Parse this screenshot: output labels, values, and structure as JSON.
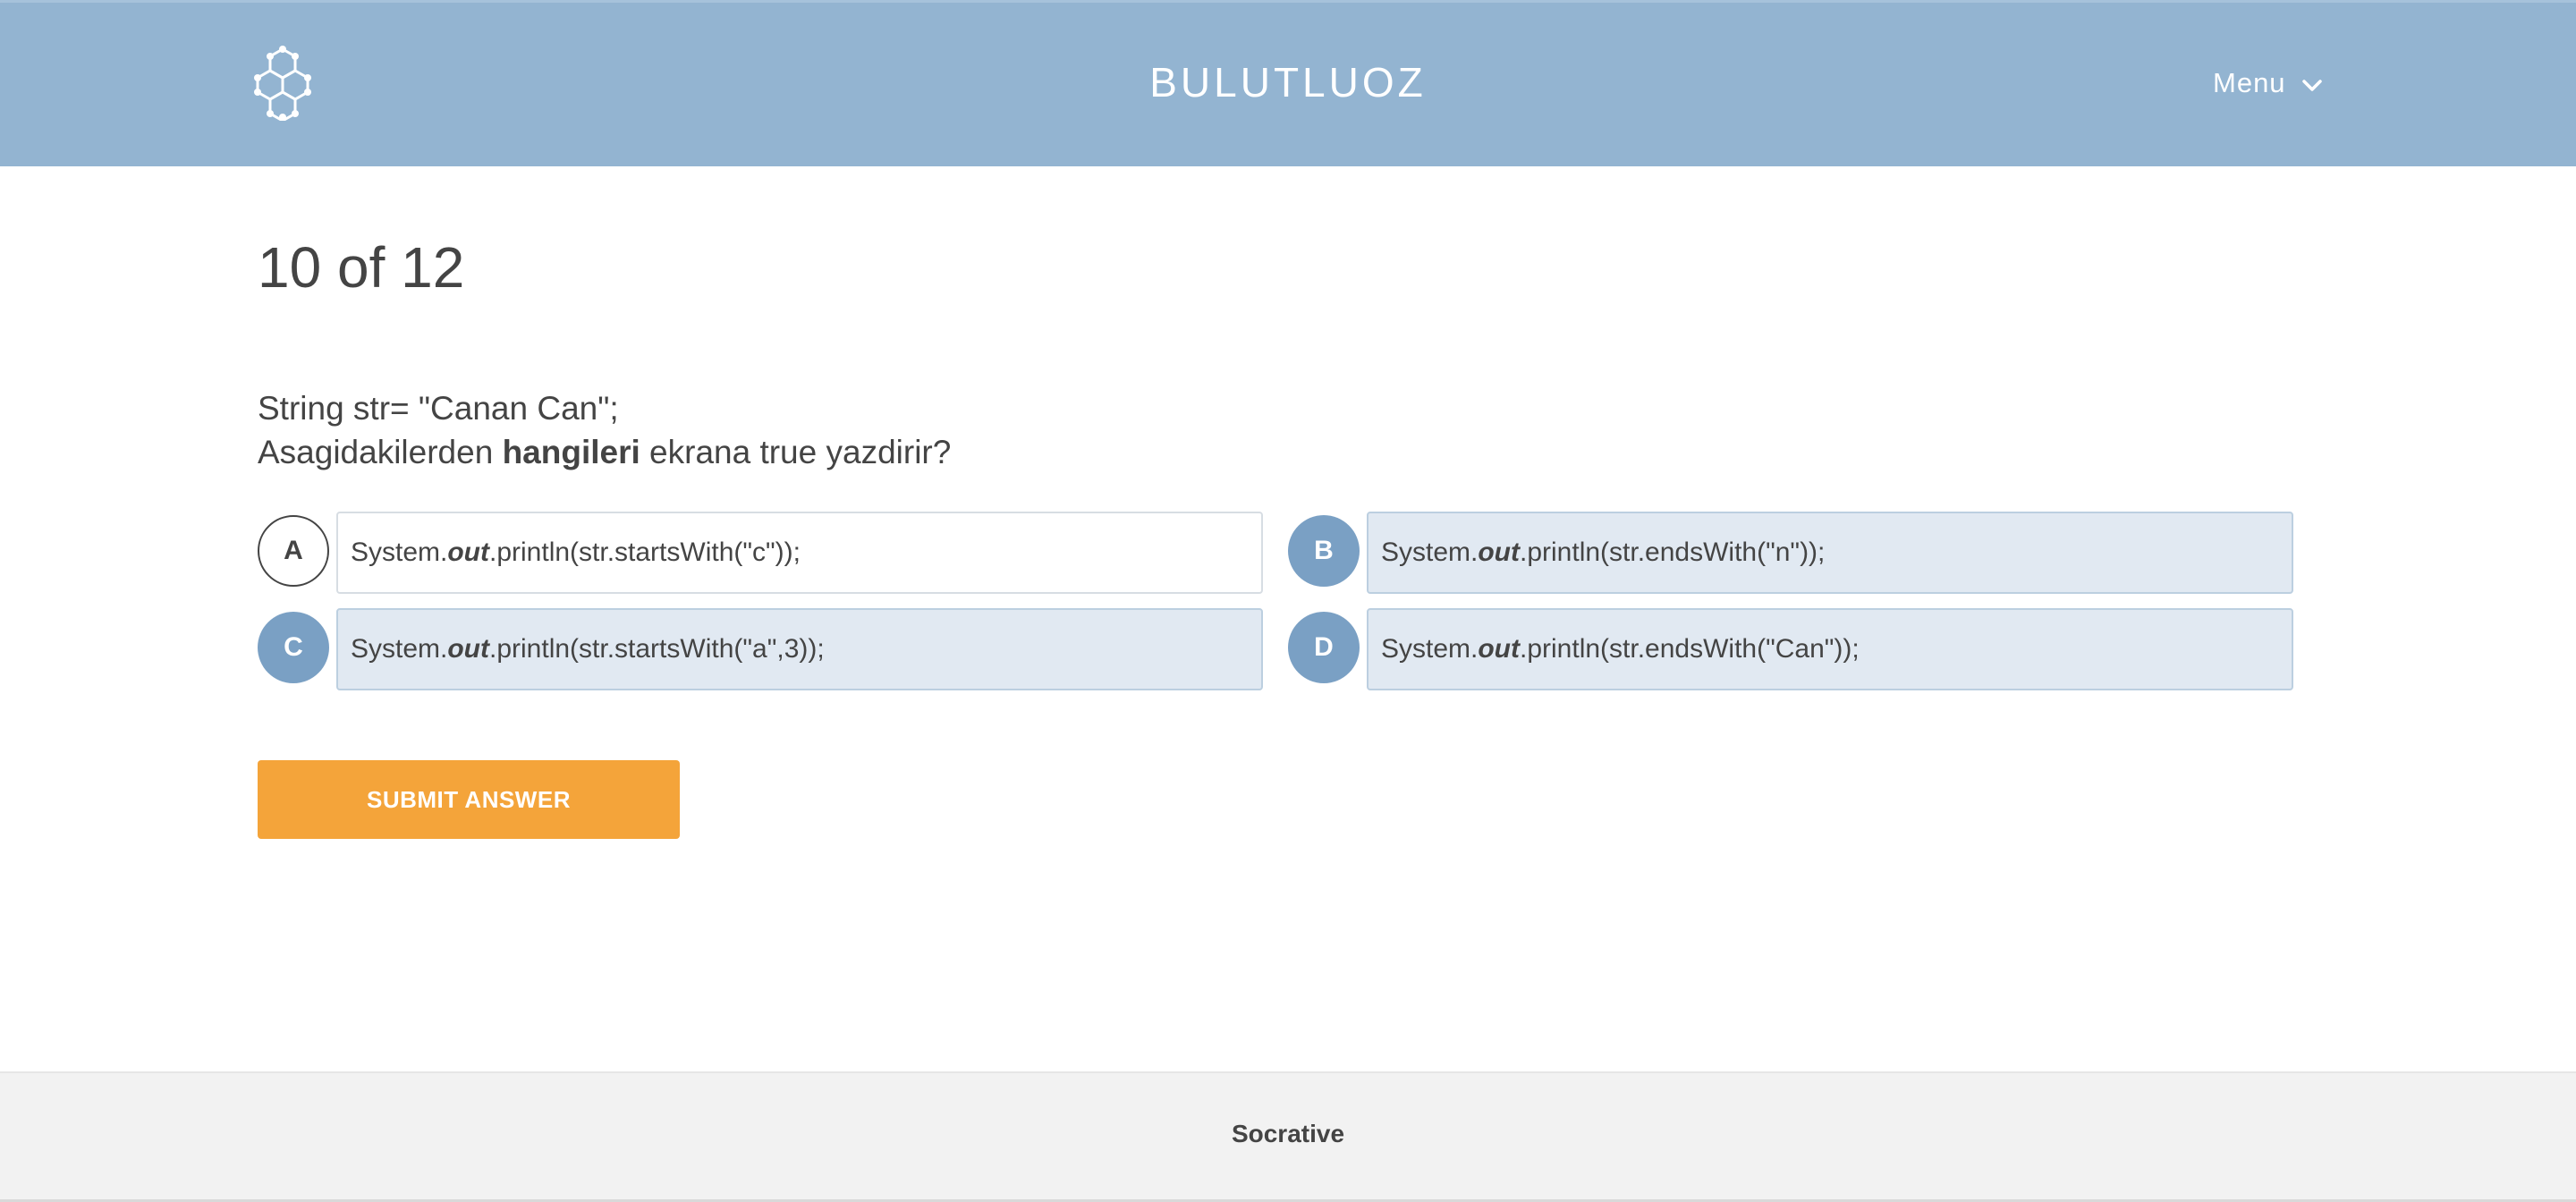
{
  "header": {
    "brand": "BULUTLUOZ",
    "menu_label": "Menu",
    "logo_icon": "hexagon-logo-icon",
    "menu_icon": "chevron-down-icon",
    "background_color": "#93b4d1"
  },
  "quiz": {
    "progress": "10 of 12",
    "current_question": 10,
    "total_questions": 12,
    "question_line1": "String str= \"Canan Can\";",
    "question_line2_before": "Asagidakilerden ",
    "question_line2_bold": "hangileri",
    "question_line2_after": " ekrana true yazdirir?",
    "choices": [
      {
        "letter": "A",
        "prefix": "System.",
        "emphasis": "out",
        "suffix": ".println(str.startsWith(\"c\"));",
        "selected": false
      },
      {
        "letter": "B",
        "prefix": "System.",
        "emphasis": "out",
        "suffix": ".println(str.endsWith(\"n\"));",
        "selected": true
      },
      {
        "letter": "C",
        "prefix": "System.",
        "emphasis": "out",
        "suffix": ".println(str.startsWith(\"a\",3));",
        "selected": true
      },
      {
        "letter": "D",
        "prefix": "System.",
        "emphasis": "out",
        "suffix": ".println(str.endsWith(\"Can\"));",
        "selected": true
      }
    ],
    "submit_label": "SUBMIT ANSWER",
    "submit_color": "#f4a43a"
  },
  "footer": {
    "text": "Socrative"
  }
}
